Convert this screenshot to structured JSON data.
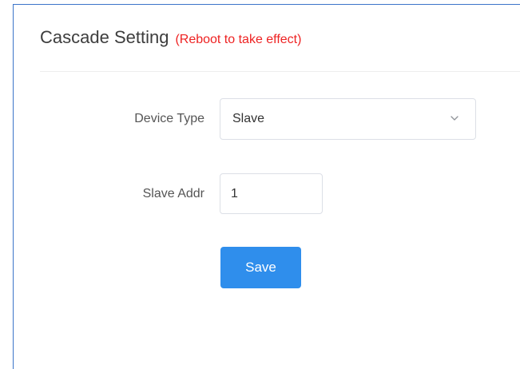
{
  "header": {
    "title": "Cascade Setting",
    "note": "(Reboot to take effect)"
  },
  "form": {
    "device_type": {
      "label": "Device Type",
      "value": "Slave"
    },
    "slave_addr": {
      "label": "Slave Addr",
      "value": "1"
    },
    "save_label": "Save"
  },
  "colors": {
    "accent": "#2f8eec",
    "warning": "#ee2222",
    "frame_border": "#3b74c9"
  }
}
